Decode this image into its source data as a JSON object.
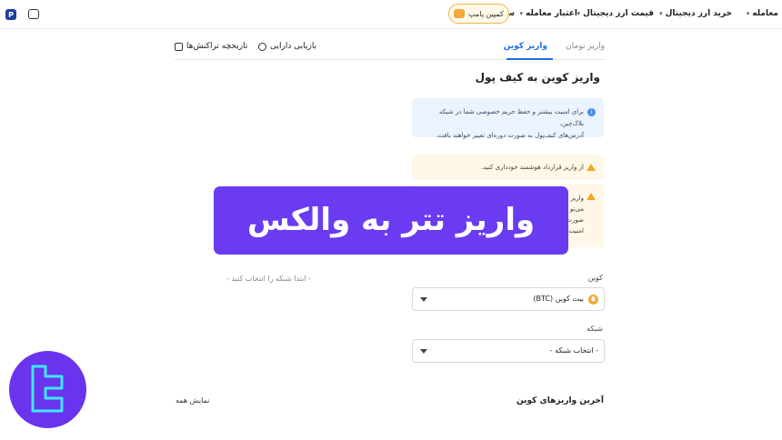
{
  "nav": {
    "items": [
      {
        "label": "معامله",
        "caret": true
      },
      {
        "label": "خرید ارز دیجیتال",
        "caret": true
      },
      {
        "label": "قیمت ارز دیجیتال",
        "caret": true
      },
      {
        "label": "اعتبار معامله",
        "caret": true
      },
      {
        "label": "سایر",
        "caret": true
      }
    ],
    "campaign_label": "کمپین پامپ",
    "brand_letter": "P"
  },
  "tabs": {
    "rial": "واریز تومان",
    "coin": "واریز کوین",
    "assets": "بازیابی دارایی",
    "history": "تاریخچه تراکنش‌ها"
  },
  "page_title": "واریز کوین به کیف پول",
  "info": {
    "line1": "برای امنیت بیشتر و حفظ حریم خصوصی شما در شبکه بلاک‌چین،",
    "line2": "آدرس‌های کیف‌پول به صورت دوره‌ای تغییر خواهند یافت."
  },
  "warnings": {
    "w1": "از واریز قرارداد هوشمند خودداری کنید.",
    "w2_lines": [
      "واریز",
      "می‌تو",
      "صورت",
      "امنیت"
    ]
  },
  "left_hint": "- ابتدا شبکه را انتخاب کنید -",
  "form": {
    "coin_label": "کوین",
    "coin_value": "بیت کوین (BTC)",
    "network_label": "شبکه",
    "network_value": "- انتخاب شبکه -"
  },
  "recent": {
    "title": "آخرین واریزهای کوین",
    "show_all": "نمایش همه"
  },
  "banner": {
    "text": "واریز تتر به والکس"
  },
  "colors": {
    "accent": "#1e6ee6",
    "banner": "#6a3bf0",
    "bitcoin": "#f2a93b"
  }
}
